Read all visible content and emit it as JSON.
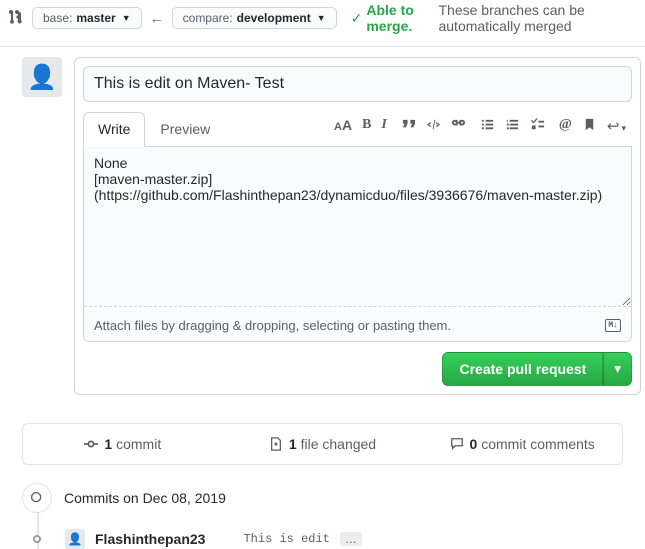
{
  "compare": {
    "base_label": "base:",
    "base_branch": "master",
    "compare_label": "compare:",
    "compare_branch": "development",
    "arrow": "←"
  },
  "merge": {
    "able": "Able to merge.",
    "rest": "These branches can be automatically merged"
  },
  "pr": {
    "title": "This is edit on Maven- Test",
    "tabs": {
      "write": "Write",
      "preview": "Preview"
    },
    "body": "None\n[maven-master.zip](https://github.com/Flashinthepan23/dynamicduo/files/3936676/maven-master.zip)",
    "attach_hint": "Attach files by dragging & dropping, selecting or pasting them.",
    "submit": "Create pull request"
  },
  "stats": {
    "commits_count": "1",
    "commits_label": "commit",
    "files_count": "1",
    "files_label": "file changed",
    "comments_count": "0",
    "comments_label": "commit comments"
  },
  "timeline": {
    "header": "Commits on Dec 08, 2019",
    "commit": {
      "author": "Flashinthepan23",
      "message": "This is edit",
      "more": "…"
    }
  }
}
